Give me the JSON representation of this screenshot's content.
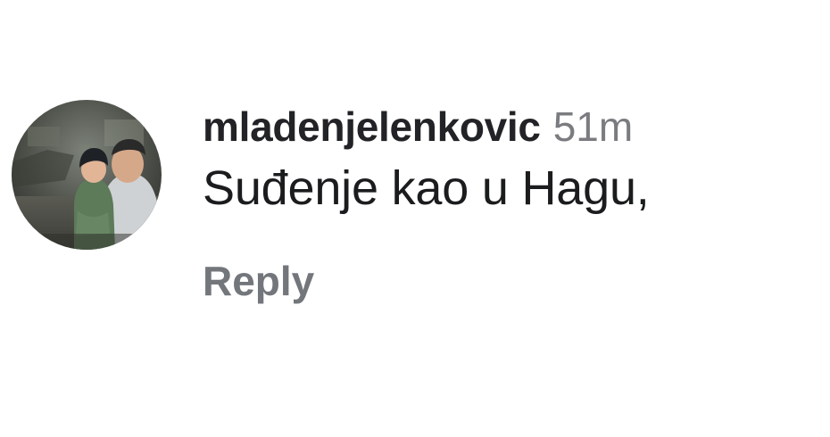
{
  "comment": {
    "avatar": {
      "icon": "user-photo-avatar",
      "alt": ""
    },
    "username": "mladenjelenkovic",
    "timestamp": "51m",
    "text": "Suđenje kao u Hagu,",
    "reply_label": "Reply"
  },
  "colors": {
    "username": "#222326",
    "timestamp": "#7a7c80",
    "text": "#1b1c1e",
    "reply": "#73767a"
  }
}
